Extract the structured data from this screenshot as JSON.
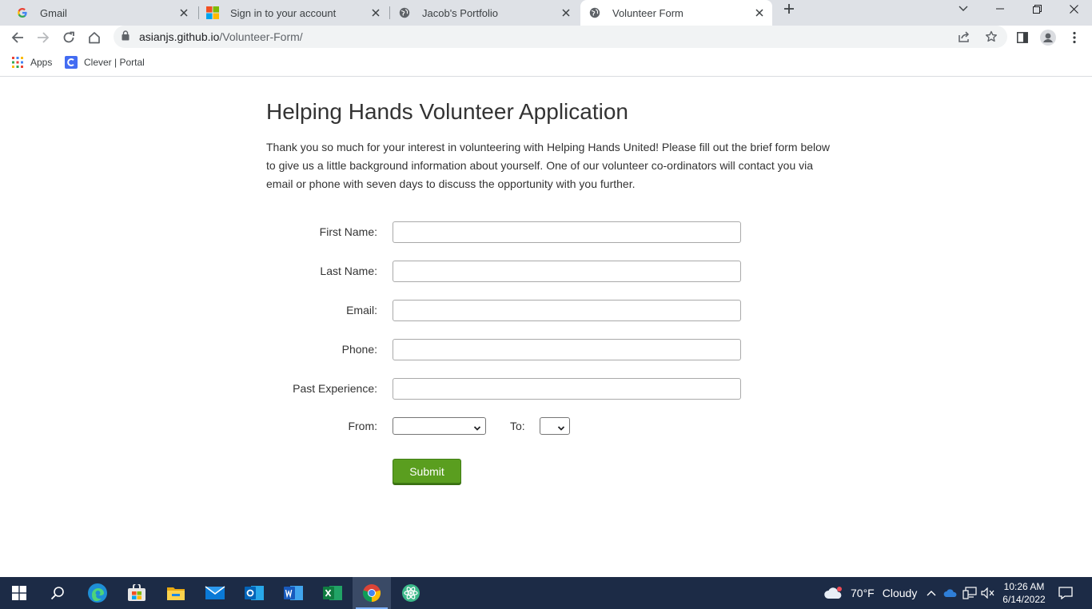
{
  "browser": {
    "tabs": [
      {
        "title": "Gmail",
        "icon": "google-g-icon",
        "active": false
      },
      {
        "title": "Sign in to your account",
        "icon": "microsoft-logo-icon",
        "active": false
      },
      {
        "title": "Jacob's Portfolio",
        "icon": "globe-icon",
        "active": false
      },
      {
        "title": "Volunteer Form",
        "icon": "globe-icon",
        "active": true
      }
    ],
    "url_host": "asianjs.github.io",
    "url_path": "/Volunteer-Form/",
    "bookmarks": [
      {
        "label": "Apps",
        "icon": "apps-grid-icon"
      },
      {
        "label": "Clever | Portal",
        "icon": "clever-c-icon"
      }
    ]
  },
  "page": {
    "title": "Helping Hands Volunteer Application",
    "intro": "Thank you so much for your interest in volunteering with Helping Hands United! Please fill out the brief form below to give us a little background information about yourself. One of our volunteer co-ordinators will contact you via email or phone with seven days to discuss the opportunity with you further.",
    "fields": {
      "first_name": {
        "label": "First Name:",
        "value": ""
      },
      "last_name": {
        "label": "Last Name:",
        "value": ""
      },
      "email": {
        "label": "Email:",
        "value": ""
      },
      "phone": {
        "label": "Phone:",
        "value": ""
      },
      "past_experience": {
        "label": "Past Experience:",
        "value": ""
      }
    },
    "from_label": "From:",
    "to_label": "To:",
    "from_value": "",
    "to_value": "",
    "submit_label": "Submit"
  },
  "taskbar": {
    "apps": [
      "start-icon",
      "search-icon",
      "edge-icon",
      "store-icon",
      "file-explorer-icon",
      "mail-icon",
      "outlook-icon",
      "word-icon",
      "excel-icon",
      "chrome-icon",
      "atom-icon"
    ],
    "weather_temp": "70°F",
    "weather_desc": "Cloudy",
    "time": "10:26 AM",
    "date": "6/14/2022"
  },
  "colors": {
    "submit_bg": "#5a9e1f",
    "taskbar_bg": "#1c2b46",
    "tabstrip_bg": "#dee1e6"
  }
}
